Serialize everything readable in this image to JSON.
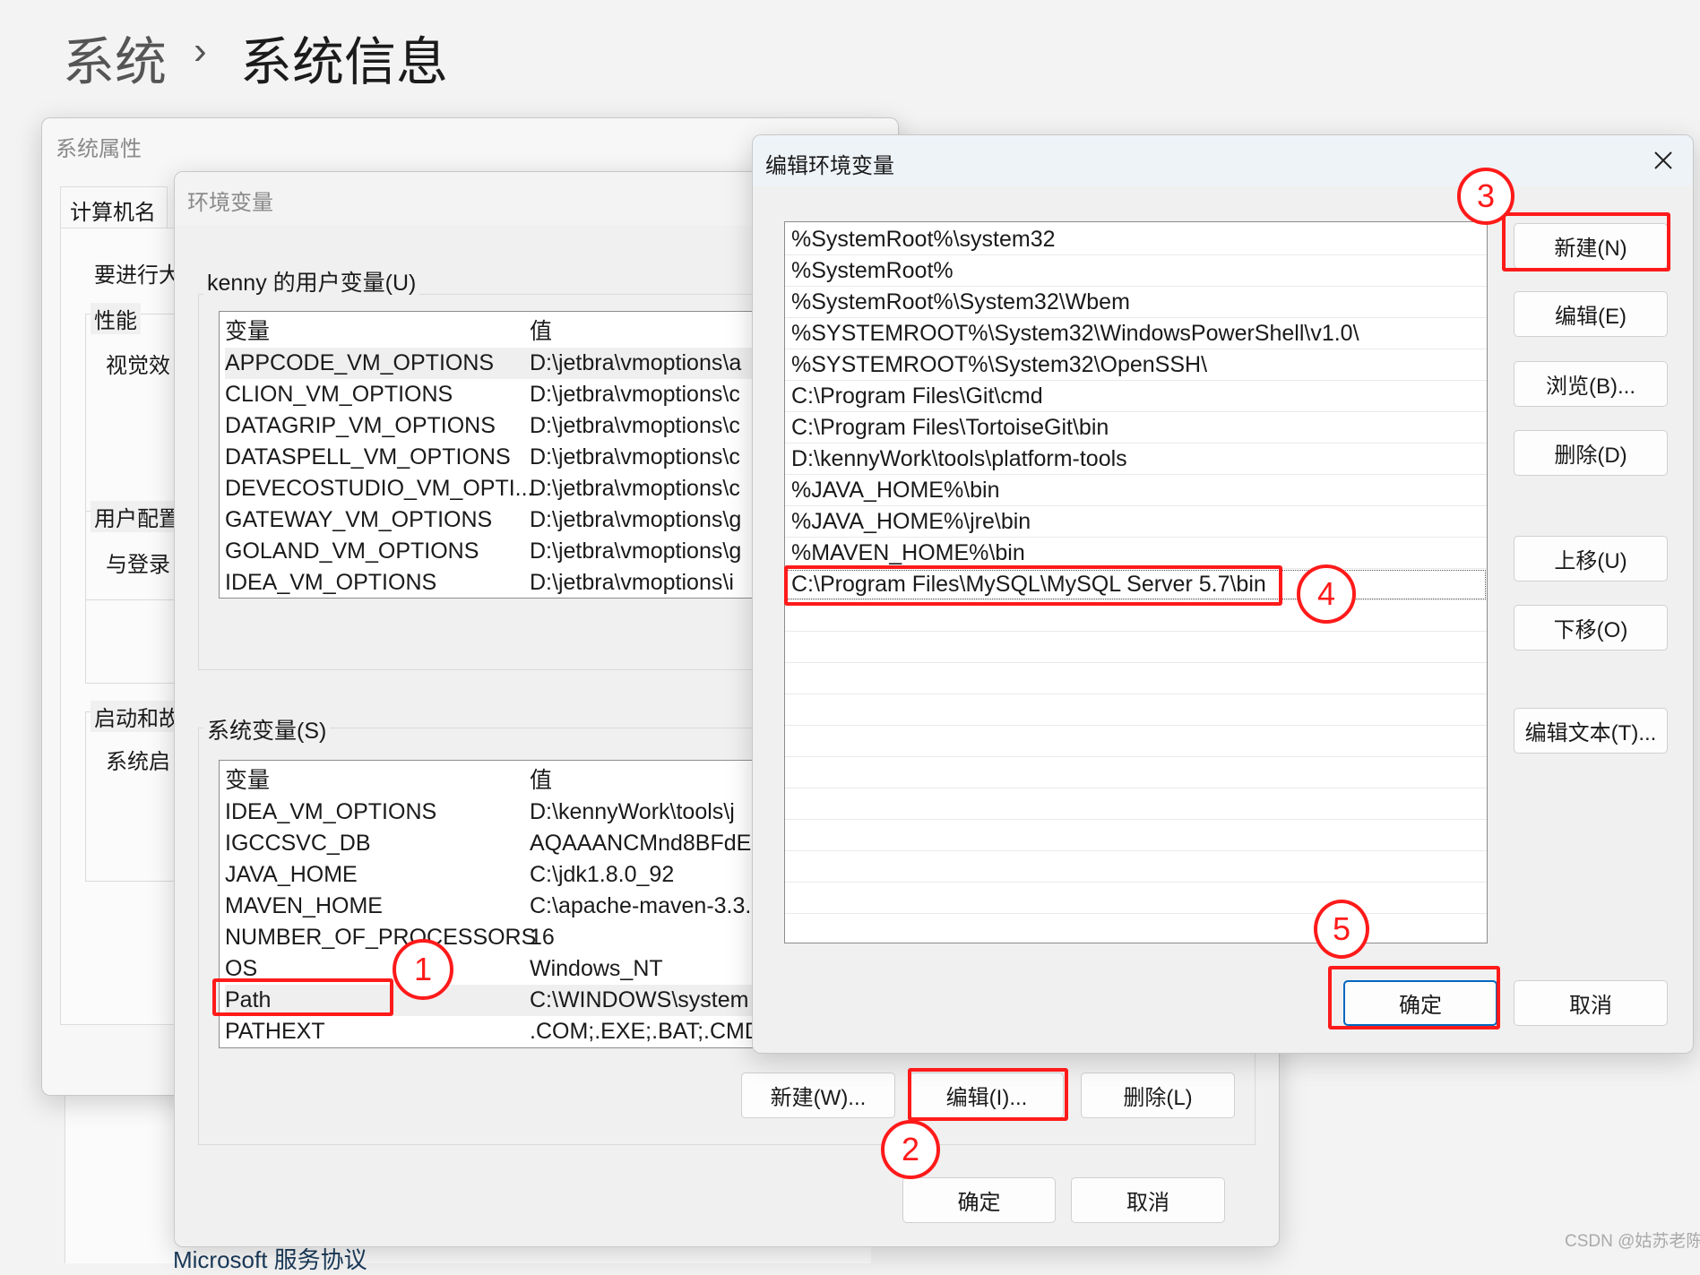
{
  "breadcrumb": {
    "parent": "系统",
    "separator": "›",
    "current": "系统信息"
  },
  "system_properties": {
    "title": "系统属性",
    "tab": "计算机名",
    "text_admin": "要进行大",
    "group_performance": "性能",
    "performance_text": "视觉效",
    "group_user_profiles": "用户配置",
    "user_profiles_text": "与登录",
    "group_startup": "启动和故",
    "startup_text": "系统启",
    "behind_link": "Microsoft 服务协议"
  },
  "env_vars": {
    "title": "环境变量",
    "user_group": "kenny 的用户变量(U)",
    "columns": [
      "变量",
      "值"
    ],
    "user_vars": [
      [
        "APPCODE_VM_OPTIONS",
        "D:\\jetbra\\vmoptions\\a"
      ],
      [
        "CLION_VM_OPTIONS",
        "D:\\jetbra\\vmoptions\\c"
      ],
      [
        "DATAGRIP_VM_OPTIONS",
        "D:\\jetbra\\vmoptions\\c"
      ],
      [
        "DATASPELL_VM_OPTIONS",
        "D:\\jetbra\\vmoptions\\c"
      ],
      [
        "DEVECOSTUDIO_VM_OPTI...",
        "D:\\jetbra\\vmoptions\\c"
      ],
      [
        "GATEWAY_VM_OPTIONS",
        "D:\\jetbra\\vmoptions\\g"
      ],
      [
        "GOLAND_VM_OPTIONS",
        "D:\\jetbra\\vmoptions\\g"
      ],
      [
        "IDEA_VM_OPTIONS",
        "D:\\jetbra\\vmoptions\\i"
      ]
    ],
    "system_group": "系统变量(S)",
    "system_vars": [
      [
        "IDEA_VM_OPTIONS",
        "D:\\kennyWork\\tools\\j"
      ],
      [
        "IGCCSVC_DB",
        "AQAAANCMnd8BFdE"
      ],
      [
        "JAVA_HOME",
        "C:\\jdk1.8.0_92"
      ],
      [
        "MAVEN_HOME",
        "C:\\apache-maven-3.3."
      ],
      [
        "NUMBER_OF_PROCESSORS",
        "16"
      ],
      [
        "OS",
        "Windows_NT"
      ],
      [
        "Path",
        "C:\\WINDOWS\\system"
      ],
      [
        "PATHEXT",
        ".COM;.EXE;.BAT;.CMD;"
      ]
    ],
    "selected_user_row": 0,
    "selected_system_row": 6,
    "new_button": "新建(W)...",
    "edit_button": "编辑(I)...",
    "delete_button": "删除(L)",
    "ok_button": "确定",
    "cancel_button": "取消"
  },
  "edit_dialog": {
    "title": "编辑环境变量",
    "close_icon": "close-icon",
    "paths": [
      "%SystemRoot%\\system32",
      "%SystemRoot%",
      "%SystemRoot%\\System32\\Wbem",
      "%SYSTEMROOT%\\System32\\WindowsPowerShell\\v1.0\\",
      "%SYSTEMROOT%\\System32\\OpenSSH\\",
      "C:\\Program Files\\Git\\cmd",
      "C:\\Program Files\\TortoiseGit\\bin",
      "D:\\kennyWork\\tools\\platform-tools",
      "%JAVA_HOME%\\bin",
      "%JAVA_HOME%\\jre\\bin",
      "%MAVEN_HOME%\\bin",
      "C:\\Program Files\\MySQL\\MySQL Server 5.7\\bin"
    ],
    "focused_row": 11,
    "buttons": {
      "new": "新建(N)",
      "edit": "编辑(E)",
      "browse": "浏览(B)...",
      "delete": "删除(D)",
      "move_up": "上移(U)",
      "move_down": "下移(O)",
      "edit_text": "编辑文本(T)...",
      "ok": "确定",
      "cancel": "取消"
    }
  },
  "annotations": {
    "color": "#ff1a1a",
    "steps": [
      "1",
      "2",
      "3",
      "4",
      "5"
    ]
  },
  "watermark": "CSDN @姑苏老陈"
}
